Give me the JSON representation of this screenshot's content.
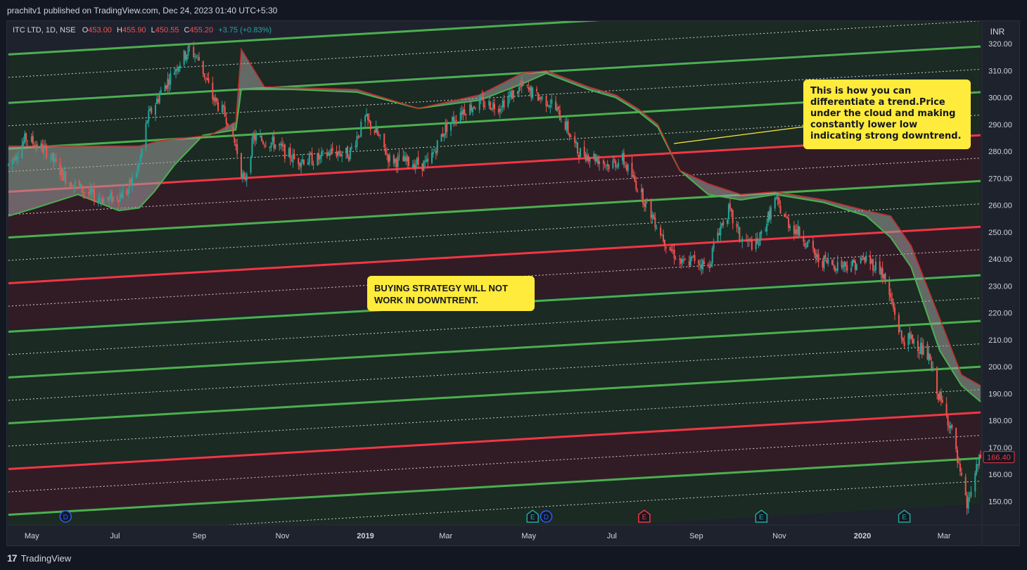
{
  "header": {
    "published_text": "prachitv1 published on TradingView.com, Dec 24, 2023 01:40 UTC+5:30"
  },
  "symbol_bar": {
    "symbol": "ITC LTD, 1D, NSE",
    "open_label": "O",
    "open": "453.00",
    "high_label": "H",
    "high": "455.90",
    "low_label": "L",
    "low": "450.55",
    "close_label": "C",
    "close": "455.20",
    "change": "+3.75 (+0.83%)"
  },
  "currency": "INR",
  "footer": {
    "brand": "TradingView"
  },
  "annotations": {
    "trend_note": "This is how you can differentiate a trend.Price under the cloud and making constantly lower low indicating strong downtrend.",
    "strategy_note": "BUYING STRATEGY WILL NOT WORK IN DOWNTRENT."
  },
  "colors": {
    "background": "#131722",
    "band_red": "#311c26",
    "band_green": "#1b2a23",
    "line_green": "#4caf50",
    "line_red": "#f23645",
    "candle_up": "#26a69a",
    "candle_down": "#ef5350",
    "cloud": "#9e9e9e",
    "callout": "#ffeb3b",
    "price_tag": "#f23645",
    "event_dividend": "#2962ff",
    "event_earnings_green": "#26a69a",
    "event_earnings_red": "#f23645"
  },
  "chart_data": {
    "type": "candlestick",
    "symbol": "ITC LTD",
    "interval": "1D",
    "exchange": "NSE",
    "ylim": [
      146,
      336
    ],
    "y_ticks": [
      150,
      160,
      170,
      180,
      190,
      200,
      210,
      220,
      230,
      240,
      250,
      260,
      270,
      280,
      290,
      300,
      310,
      320
    ],
    "x_ticks": [
      "May",
      "Jul",
      "Sep",
      "Nov",
      "2019",
      "Mar",
      "May",
      "Jul",
      "Sep",
      "Nov",
      "2020",
      "Mar"
    ],
    "bold_x_ticks": [
      "2019",
      "2020"
    ],
    "last_price": "166.40",
    "price_path": [
      [
        "2018-04-20",
        275
      ],
      [
        "2018-05-03",
        285
      ],
      [
        "2018-05-18",
        280
      ],
      [
        "2018-06-01",
        270
      ],
      [
        "2018-06-18",
        264
      ],
      [
        "2018-07-02",
        262
      ],
      [
        "2018-07-16",
        265
      ],
      [
        "2018-07-25",
        275
      ],
      [
        "2018-07-31",
        292
      ],
      [
        "2018-08-10",
        302
      ],
      [
        "2018-08-22",
        312
      ],
      [
        "2018-08-31",
        318
      ],
      [
        "2018-09-07",
        314
      ],
      [
        "2018-09-17",
        300
      ],
      [
        "2018-09-28",
        292
      ],
      [
        "2018-10-05",
        280
      ],
      [
        "2018-10-10",
        268
      ],
      [
        "2018-10-17",
        285
      ],
      [
        "2018-11-01",
        283
      ],
      [
        "2018-11-16",
        277
      ],
      [
        "2018-12-03",
        277
      ],
      [
        "2018-12-14",
        280
      ],
      [
        "2018-12-26",
        279
      ],
      [
        "2019-01-07",
        292
      ],
      [
        "2019-01-15",
        287
      ],
      [
        "2019-01-25",
        277
      ],
      [
        "2019-02-08",
        276
      ],
      [
        "2019-02-22",
        275
      ],
      [
        "2019-03-06",
        288
      ],
      [
        "2019-03-18",
        295
      ],
      [
        "2019-04-01",
        298
      ],
      [
        "2019-04-15",
        297
      ],
      [
        "2019-05-02",
        304
      ],
      [
        "2019-05-15",
        300
      ],
      [
        "2019-05-24",
        298
      ],
      [
        "2019-06-03",
        290
      ],
      [
        "2019-06-12",
        280
      ],
      [
        "2019-06-24",
        278
      ],
      [
        "2019-07-05",
        275
      ],
      [
        "2019-07-15",
        277
      ],
      [
        "2019-07-26",
        267
      ],
      [
        "2019-08-06",
        256
      ],
      [
        "2019-08-16",
        246
      ],
      [
        "2019-08-28",
        238
      ],
      [
        "2019-09-06",
        240
      ],
      [
        "2019-09-16",
        237
      ],
      [
        "2019-09-23",
        250
      ],
      [
        "2019-10-01",
        258
      ],
      [
        "2019-10-10",
        247
      ],
      [
        "2019-10-22",
        245
      ],
      [
        "2019-11-04",
        262
      ],
      [
        "2019-11-13",
        254
      ],
      [
        "2019-11-25",
        248
      ],
      [
        "2019-12-05",
        240
      ],
      [
        "2019-12-17",
        238
      ],
      [
        "2019-12-31",
        238
      ],
      [
        "2020-01-10",
        240
      ],
      [
        "2020-01-21",
        236
      ],
      [
        "2020-01-31",
        220
      ],
      [
        "2020-02-05",
        210
      ],
      [
        "2020-02-14",
        210
      ],
      [
        "2020-02-25",
        203
      ],
      [
        "2020-03-04",
        188
      ],
      [
        "2020-03-12",
        178
      ],
      [
        "2020-03-18",
        162
      ],
      [
        "2020-03-24",
        148
      ],
      [
        "2020-03-30",
        160
      ],
      [
        "2020-04-03",
        166.4
      ]
    ],
    "cloud_upper": [
      [
        "2018-04-20",
        282
      ],
      [
        "2018-06-01",
        282
      ],
      [
        "2018-07-25",
        282
      ],
      [
        "2018-08-10",
        284
      ],
      [
        "2018-09-15",
        286
      ],
      [
        "2018-10-04",
        291
      ],
      [
        "2018-10-08",
        318
      ],
      [
        "2018-10-25",
        304
      ],
      [
        "2019-01-01",
        303
      ],
      [
        "2019-02-15",
        296
      ],
      [
        "2019-04-01",
        301
      ],
      [
        "2019-05-02",
        309
      ],
      [
        "2019-05-20",
        310
      ],
      [
        "2019-06-20",
        304
      ],
      [
        "2019-07-10",
        301
      ],
      [
        "2019-07-26",
        296
      ],
      [
        "2019-08-10",
        290
      ],
      [
        "2019-08-26",
        273
      ],
      [
        "2019-09-16",
        268
      ],
      [
        "2019-10-10",
        264
      ],
      [
        "2019-11-04",
        265
      ],
      [
        "2019-12-10",
        262
      ],
      [
        "2020-01-10",
        258
      ],
      [
        "2020-01-28",
        256
      ],
      [
        "2020-02-12",
        245
      ],
      [
        "2020-03-04",
        218
      ],
      [
        "2020-03-20",
        197
      ],
      [
        "2020-04-03",
        193
      ]
    ],
    "cloud_lower": [
      [
        "2018-04-20",
        256
      ],
      [
        "2018-05-10",
        259
      ],
      [
        "2018-06-10",
        264
      ],
      [
        "2018-07-10",
        258
      ],
      [
        "2018-07-25",
        259
      ],
      [
        "2018-08-05",
        265
      ],
      [
        "2018-08-20",
        275
      ],
      [
        "2018-09-10",
        286
      ],
      [
        "2018-10-04",
        288
      ],
      [
        "2018-10-08",
        303
      ],
      [
        "2018-11-15",
        303
      ],
      [
        "2019-01-01",
        302
      ],
      [
        "2019-02-15",
        296
      ],
      [
        "2019-04-01",
        299
      ],
      [
        "2019-05-02",
        305
      ],
      [
        "2019-05-20",
        309
      ],
      [
        "2019-06-20",
        303
      ],
      [
        "2019-07-10",
        300
      ],
      [
        "2019-07-26",
        295
      ],
      [
        "2019-08-10",
        289
      ],
      [
        "2019-08-26",
        273
      ],
      [
        "2019-09-16",
        264
      ],
      [
        "2019-10-10",
        262
      ],
      [
        "2019-11-04",
        264
      ],
      [
        "2019-12-10",
        261
      ],
      [
        "2020-01-10",
        256
      ],
      [
        "2020-01-28",
        248
      ],
      [
        "2020-02-12",
        237
      ],
      [
        "2020-03-04",
        206
      ],
      [
        "2020-03-20",
        193
      ],
      [
        "2020-04-03",
        187
      ]
    ],
    "channel": {
      "x_start": "2018-04-20",
      "x_end": "2020-04-03",
      "bands": [
        {
          "color": "green",
          "y_start": 316,
          "y_end": 337
        },
        {
          "color": "green",
          "y_start": 298,
          "y_end": 319
        },
        {
          "color": "green",
          "y_start": 281,
          "y_end": 302
        },
        {
          "color": "red",
          "y_start": 265,
          "y_end": 286
        },
        {
          "color": "green",
          "y_start": 248,
          "y_end": 269
        },
        {
          "color": "red",
          "y_start": 231,
          "y_end": 252
        },
        {
          "color": "green",
          "y_start": 213,
          "y_end": 234
        },
        {
          "color": "green",
          "y_start": 196,
          "y_end": 217
        },
        {
          "color": "green",
          "y_start": 179,
          "y_end": 200
        },
        {
          "color": "red",
          "y_start": 162,
          "y_end": 183
        },
        {
          "color": "green",
          "y_start": 145,
          "y_end": 166
        }
      ]
    },
    "events": [
      {
        "type": "dividend",
        "label": "D",
        "date": "2018-06-01"
      },
      {
        "type": "earnings",
        "label": "E",
        "date": "2019-05-10",
        "color": "green"
      },
      {
        "type": "dividend",
        "label": "D",
        "date": "2019-05-20"
      },
      {
        "type": "earnings",
        "label": "E",
        "date": "2019-07-31",
        "color": "red"
      },
      {
        "type": "earnings",
        "label": "E",
        "date": "2019-10-25",
        "color": "green"
      },
      {
        "type": "earnings",
        "label": "E",
        "date": "2020-02-07",
        "color": "green"
      }
    ]
  }
}
